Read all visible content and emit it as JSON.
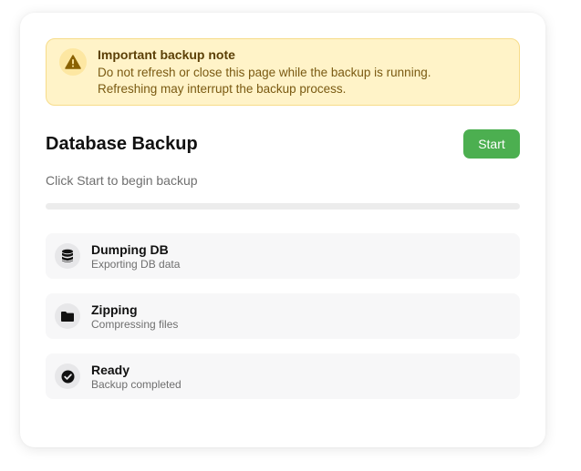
{
  "note": {
    "title": "Important backup note",
    "line1": "Do not refresh or close this page while the backup is running.",
    "line2": "Refreshing may interrupt the backup process.",
    "icon": "warning-icon"
  },
  "header": {
    "title": "Database Backup",
    "start_label": "Start"
  },
  "status": {
    "text": "Click Start to begin backup"
  },
  "progress": {
    "value": 0
  },
  "steps": [
    {
      "title": "Dumping DB",
      "subtitle": "Exporting DB data",
      "icon": "database-icon"
    },
    {
      "title": "Zipping",
      "subtitle": "Compressing files",
      "icon": "folder-icon"
    },
    {
      "title": "Ready",
      "subtitle": "Backup completed",
      "icon": "check-circle-icon"
    }
  ],
  "colors": {
    "accent": "#4caf50",
    "note_background": "#fff3c8",
    "note_border": "#f7dc8a",
    "note_title": "#5b3f06",
    "step_background": "#f7f7f8"
  }
}
